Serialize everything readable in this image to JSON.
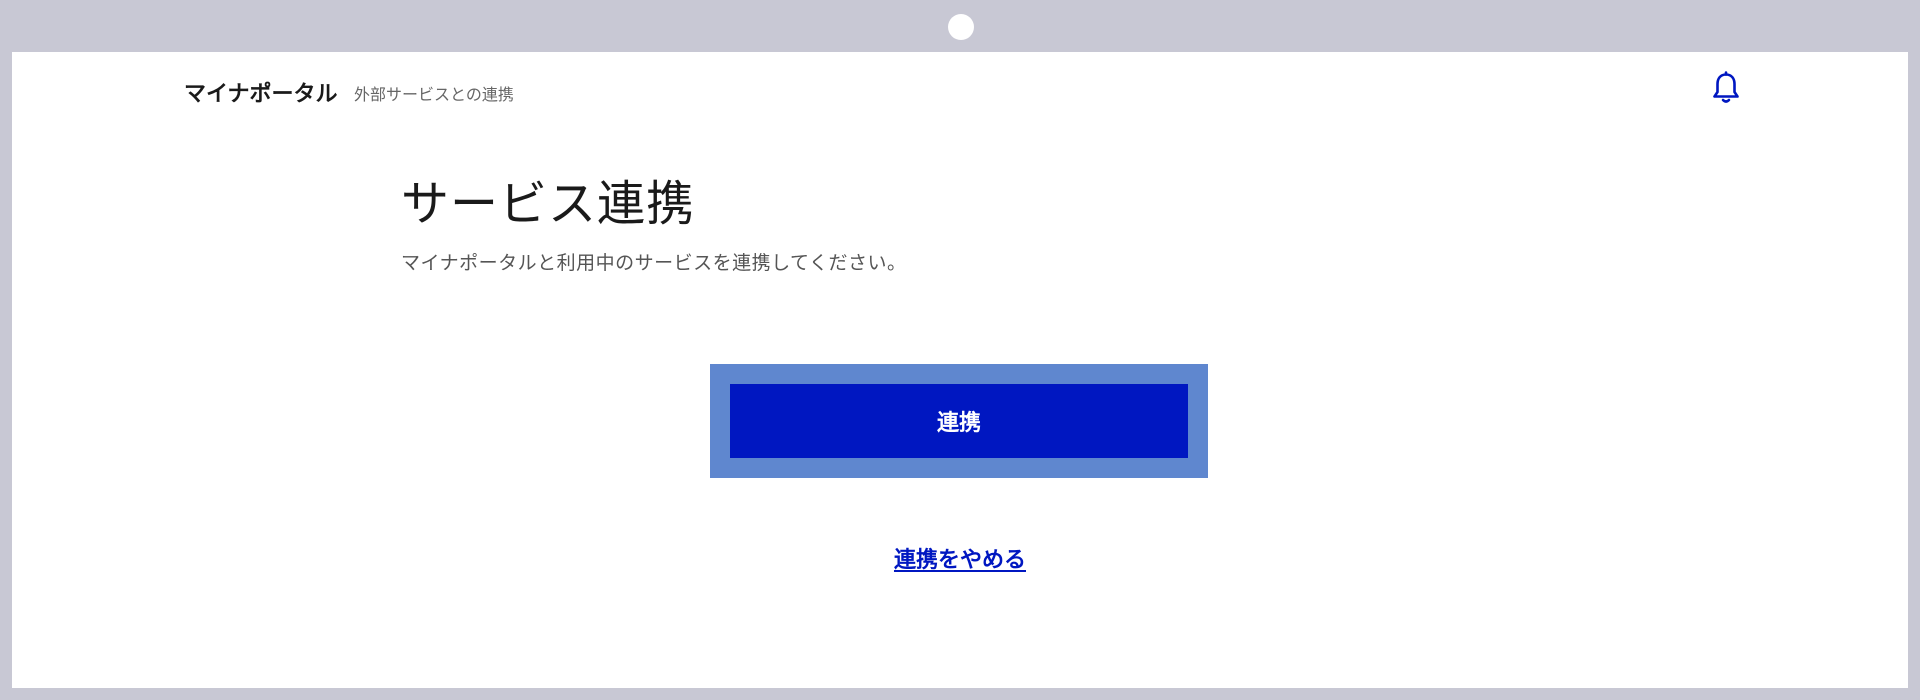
{
  "header": {
    "brand": "マイナポータル",
    "subtitle": "外部サービスとの連携",
    "notification_icon": "bell-icon"
  },
  "main": {
    "title": "サービス連携",
    "description": "マイナポータルと利用中のサービスを連携してください。",
    "connect_label": "連携",
    "cancel_label": "連携をやめる"
  },
  "colors": {
    "primary": "#0017c1",
    "focus_ring": "#5f87cf",
    "frame": "#c8c8d4"
  }
}
